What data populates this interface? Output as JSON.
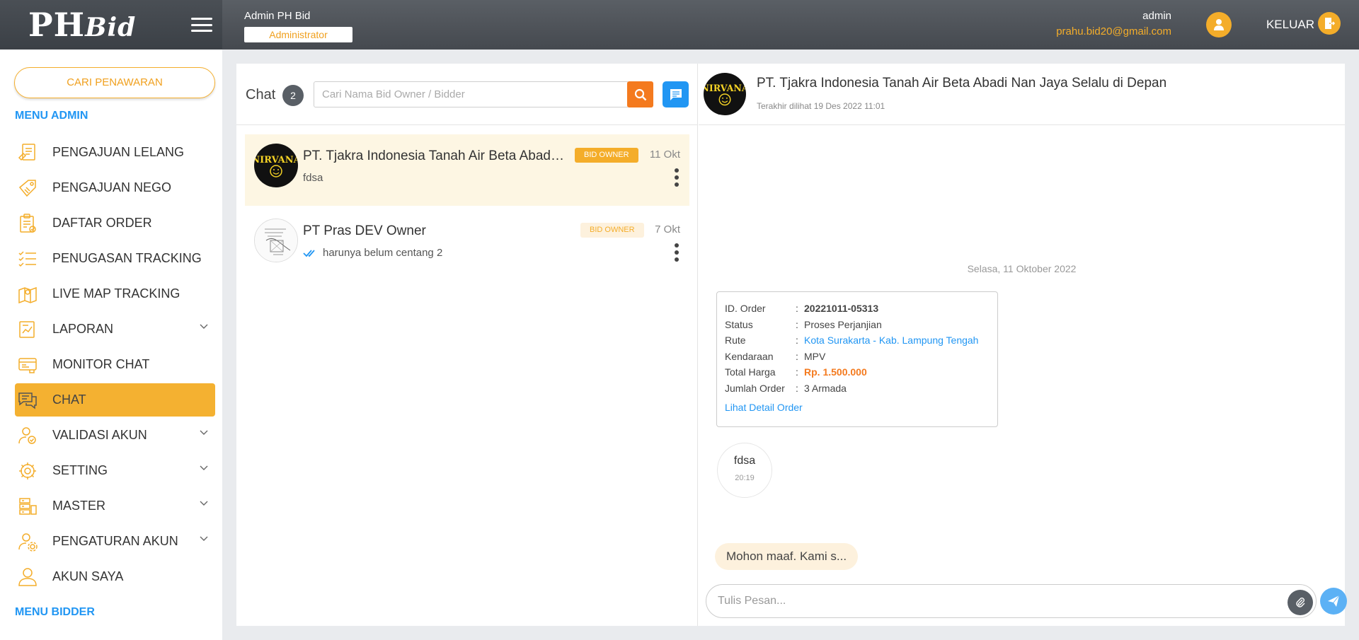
{
  "header": {
    "logo_main": "PH",
    "logo_sub": "Bid",
    "user_title": "Admin PH Bid",
    "role": "Administrator",
    "admin_name": "admin",
    "admin_email": "prahu.bid20@gmail.com",
    "logout_label": "KELUAR"
  },
  "sidebar": {
    "search_offer_label": "CARI PENAWARAN",
    "admin_section": "MENU ADMIN",
    "bidder_section": "MENU BIDDER",
    "items": [
      {
        "label": "PENGAJUAN LELANG",
        "icon": "auction-request-icon"
      },
      {
        "label": "PENGAJUAN NEGO",
        "icon": "negotiation-tag-icon"
      },
      {
        "label": "DAFTAR ORDER",
        "icon": "clipboard-order-icon"
      },
      {
        "label": "PENUGASAN TRACKING",
        "icon": "checklist-icon"
      },
      {
        "label": "LIVE MAP TRACKING",
        "icon": "map-pin-icon"
      },
      {
        "label": "LAPORAN",
        "icon": "report-chart-icon"
      },
      {
        "label": "MONITOR CHAT",
        "icon": "monitor-chat-icon"
      },
      {
        "label": "CHAT",
        "icon": "chat-bubbles-icon"
      },
      {
        "label": "VALIDASI AKUN",
        "icon": "user-check-icon"
      },
      {
        "label": "SETTING",
        "icon": "gear-icon"
      },
      {
        "label": "MASTER",
        "icon": "server-icon"
      },
      {
        "label": "PENGATURAN AKUN",
        "icon": "user-settings-icon"
      },
      {
        "label": "AKUN SAYA",
        "icon": "user-icon"
      }
    ],
    "active_item": "CHAT"
  },
  "chat_list": {
    "title": "Chat",
    "count": "2",
    "search_placeholder": "Cari Nama Bid Owner / Bidder",
    "conversations": [
      {
        "name": "PT. Tjakra Indonesia Tanah Air Beta Abadi Nan Jaya Selalu di Depan",
        "preview": "fdsa",
        "role": "BID OWNER",
        "date": "11 Okt"
      },
      {
        "name": "PT Pras DEV Owner",
        "preview": "harunya belum centang 2",
        "role": "BID OWNER",
        "date": "7 Okt"
      }
    ]
  },
  "chat_window": {
    "name": "PT. Tjakra Indonesia Tanah Air Beta Abadi Nan Jaya Selalu di Depan",
    "last_seen": "Terakhir dilihat 19 Des 2022 11:01",
    "date_separator": "Selasa, 11 Oktober 2022",
    "order": {
      "rows": [
        {
          "key": "ID. Order",
          "value": "20221011-05313"
        },
        {
          "key": "Status",
          "value": "Proses Perjanjian"
        },
        {
          "key": "Rute",
          "value": "Kota Surakarta - Kab. Lampung Tengah"
        },
        {
          "key": "Kendaraan",
          "value": "MPV"
        },
        {
          "key": "Total Harga",
          "value": "Rp. 1.500.000"
        },
        {
          "key": "Jumlah Order",
          "value": "3 Armada"
        }
      ],
      "detail_link": "Lihat Detail Order"
    },
    "message_in": {
      "text": "fdsa",
      "time": "20:19"
    },
    "reply_preview": "Mohon maaf. Kami s...",
    "compose_placeholder": "Tulis Pesan..."
  },
  "colors": {
    "accent": "#f4ad2a",
    "blue": "#2196f3",
    "orange": "#f47a1e",
    "header_dark": "#45494f"
  }
}
